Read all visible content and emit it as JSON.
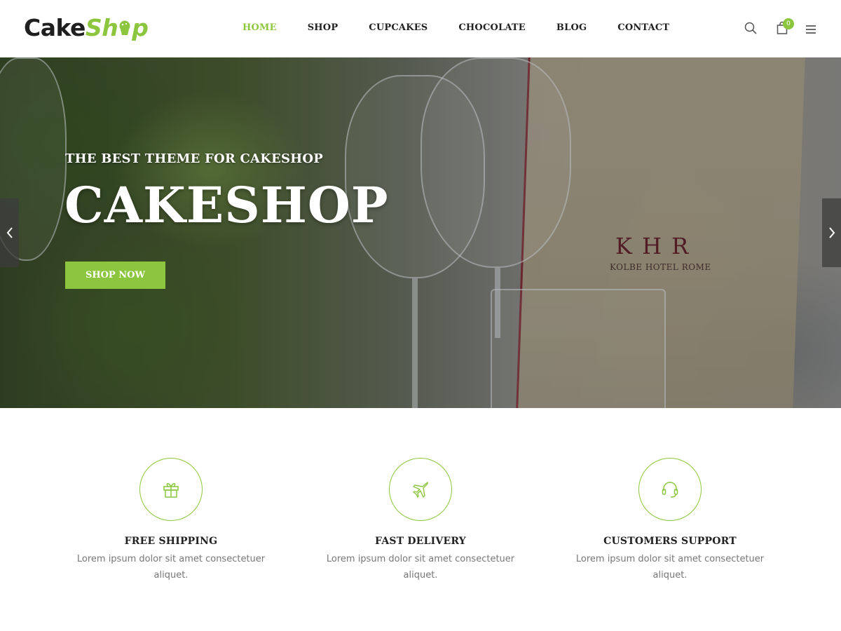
{
  "brand": {
    "logo_part1": "Cake",
    "logo_part2": "Sh",
    "logo_part3": "p",
    "colors": {
      "accent": "#8cc63f",
      "text": "#222222",
      "muted": "#777777"
    }
  },
  "nav": {
    "items": [
      {
        "label": "HOME",
        "active": true
      },
      {
        "label": "SHOP",
        "active": false
      },
      {
        "label": "CUPCAKES",
        "active": false
      },
      {
        "label": "CHOCOLATE",
        "active": false
      },
      {
        "label": "BLOG",
        "active": false
      },
      {
        "label": "CONTACT",
        "active": false
      }
    ]
  },
  "header_icons": {
    "search": "search-icon",
    "cart": "shopping-bag-icon",
    "cart_count": "0",
    "menu": "hamburger-menu-icon"
  },
  "hero": {
    "subtitle": "THE BEST THEME FOR CAKESHOP",
    "title": "CAKESHOP",
    "button_label": "SHOP NOW",
    "menu_card_logo": "K H R",
    "menu_card_name": "KOLBE HOTEL ROME",
    "prev_icon": "chevron-left-icon",
    "next_icon": "chevron-right-icon"
  },
  "features": [
    {
      "icon": "gift-icon",
      "title": "FREE SHIPPING",
      "text": "Lorem ipsum dolor sit amet consectetuer aliquet."
    },
    {
      "icon": "airplane-icon",
      "title": "FAST DELIVERY",
      "text": "Lorem ipsum dolor sit amet consectetuer aliquet."
    },
    {
      "icon": "headset-icon",
      "title": "CUSTOMERS SUPPORT",
      "text": "Lorem ipsum dolor sit amet consectetuer aliquet."
    }
  ]
}
